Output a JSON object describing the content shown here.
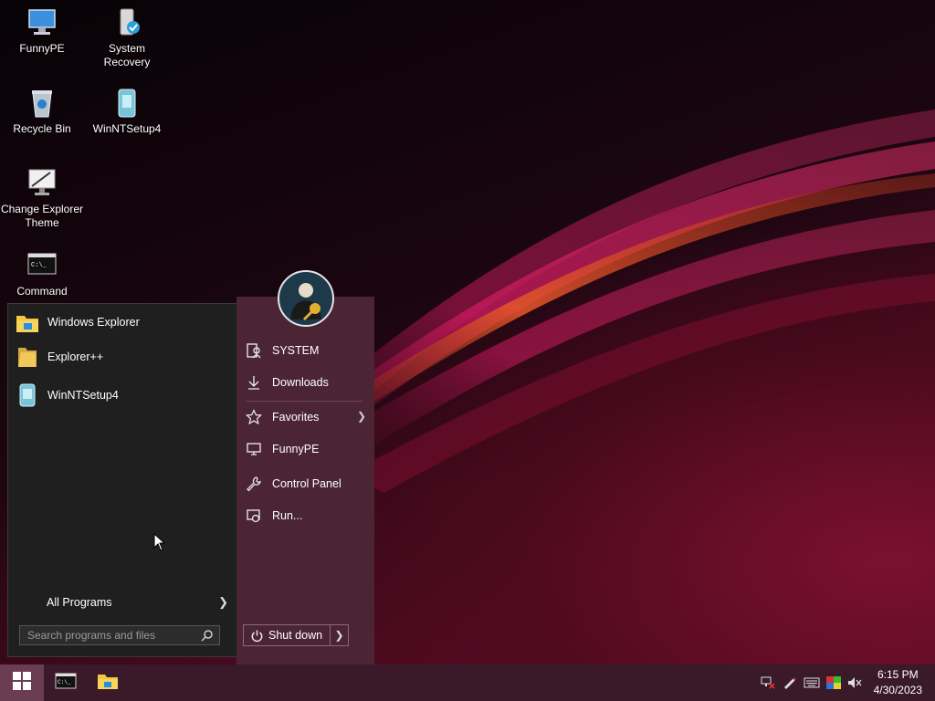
{
  "desktop": {
    "icons": [
      {
        "label": "FunnyPE",
        "icon": "computer-icon"
      },
      {
        "label": "System Recovery",
        "icon": "system-recovery-icon"
      },
      {
        "label": "Recycle Bin",
        "icon": "recycle-bin-icon"
      },
      {
        "label": "WinNTSetup4",
        "icon": "winntsetup-icon"
      },
      {
        "label": "Change Explorer Theme",
        "icon": "monitor-icon"
      },
      {
        "label": "Command",
        "icon": "command-prompt-icon"
      }
    ]
  },
  "start_menu": {
    "programs": [
      {
        "label": "Windows Explorer",
        "icon": "explorer-folder-icon"
      },
      {
        "label": "Explorer++",
        "icon": "folder-icon"
      },
      {
        "label": "WinNTSetup4",
        "icon": "winntsetup-icon"
      }
    ],
    "all_programs": "All Programs",
    "search_placeholder": "Search programs and files",
    "right_items": [
      {
        "label": "SYSTEM",
        "icon": "user-folder-icon"
      },
      {
        "label": "Downloads",
        "icon": "download-icon"
      },
      {
        "label": "Favorites",
        "icon": "star-icon"
      },
      {
        "label": "FunnyPE",
        "icon": "computer-icon"
      },
      {
        "label": "Control Panel",
        "icon": "wrench-icon"
      },
      {
        "label": "Run...",
        "icon": "run-icon"
      }
    ],
    "shutdown_label": "Shut down"
  },
  "taskbar": {
    "time": "6:15 PM",
    "date": "4/30/2023"
  },
  "colors": {
    "accent": "#6b3d52",
    "start_right_bg": "#4c2535",
    "start_left_bg": "#1f1f1f"
  }
}
